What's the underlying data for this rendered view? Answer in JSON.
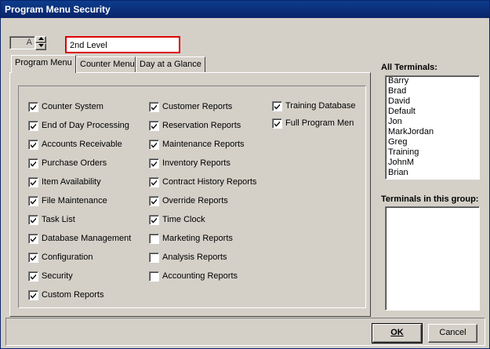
{
  "window": {
    "title": "Program Menu Security"
  },
  "spinner": {
    "value": "A"
  },
  "level_name": {
    "value": "2nd Level"
  },
  "tabs": [
    {
      "label": "Program Menu"
    },
    {
      "label": "Counter Menu"
    },
    {
      "label": "Day at a Glance"
    }
  ],
  "program_menu": {
    "col1": [
      {
        "label": "Counter System",
        "checked": true
      },
      {
        "label": "End of Day Processing",
        "checked": true
      },
      {
        "label": "Accounts Receivable",
        "checked": true
      },
      {
        "label": "Purchase Orders",
        "checked": true
      },
      {
        "label": "Item Availability",
        "checked": true
      },
      {
        "label": "File Maintenance",
        "checked": true
      },
      {
        "label": "Task List",
        "checked": true
      },
      {
        "label": "Database Management",
        "checked": true
      },
      {
        "label": "Configuration",
        "checked": true
      },
      {
        "label": "Security",
        "checked": true
      },
      {
        "label": "Custom Reports",
        "checked": true
      }
    ],
    "col2": [
      {
        "label": "Customer Reports",
        "checked": true
      },
      {
        "label": "Reservation Reports",
        "checked": true
      },
      {
        "label": "Maintenance Reports",
        "checked": true
      },
      {
        "label": "Inventory Reports",
        "checked": true
      },
      {
        "label": "Contract History Reports",
        "checked": true
      },
      {
        "label": "Override Reports",
        "checked": true
      },
      {
        "label": "Time Clock",
        "checked": true
      },
      {
        "label": "Marketing Reports",
        "checked": false
      },
      {
        "label": "Analysis Reports",
        "checked": false
      },
      {
        "label": "Accounting Reports",
        "checked": false
      }
    ],
    "col3": [
      {
        "label": "Training Database",
        "checked": true
      },
      {
        "label": "Full  Program Men",
        "checked": true
      }
    ]
  },
  "all_terminals": {
    "label": "All Terminals:",
    "items": [
      "Barry",
      "Brad",
      "David",
      "Default",
      "Jon",
      "MarkJordan",
      "Greg",
      "Training",
      "JohnM",
      "Brian"
    ]
  },
  "group_terminals": {
    "label": "Terminals in this group:",
    "items": []
  },
  "buttons": {
    "ok": "OK",
    "cancel": "Cancel"
  },
  "colors": {
    "titlebar": "#0a246a",
    "face": "#d4d0c8",
    "highlight_border": "#e00000"
  }
}
